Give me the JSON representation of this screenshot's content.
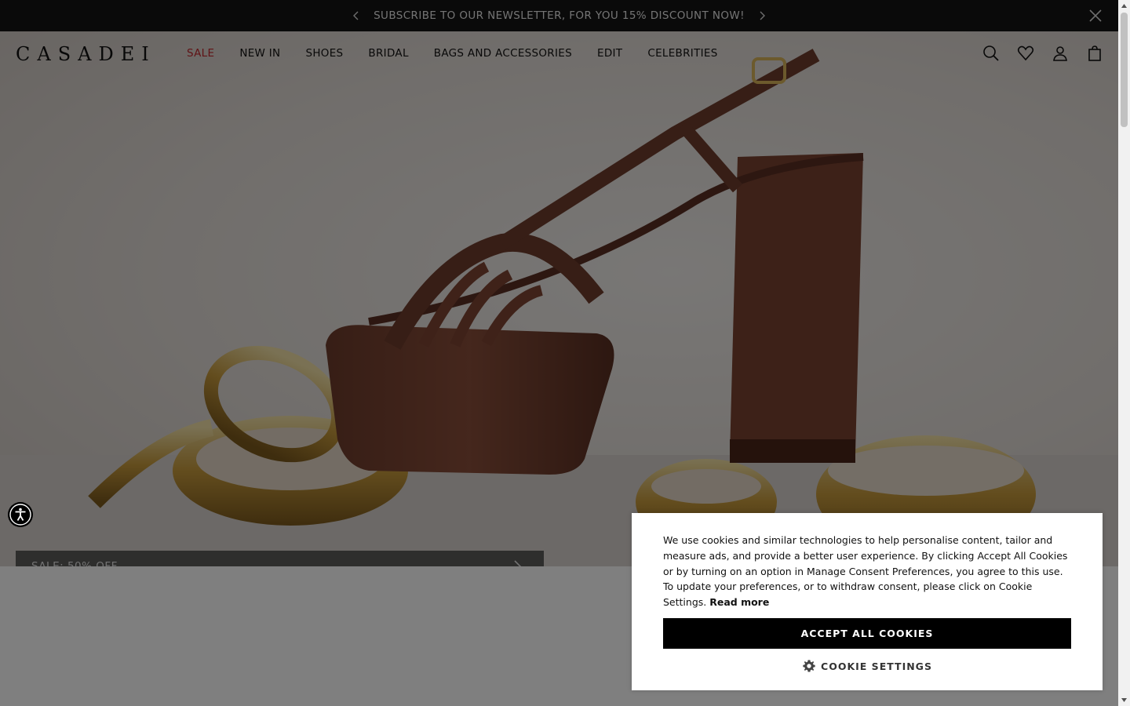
{
  "announcement": {
    "text": "SUBSCRIBE TO OUR NEWSLETTER, FOR YOU 15% DISCOUNT NOW!"
  },
  "header": {
    "logo": "CASADEI",
    "nav": [
      {
        "label": "SALE",
        "highlight": "#c0272d"
      },
      {
        "label": "NEW IN"
      },
      {
        "label": "SHOES"
      },
      {
        "label": "BRIDAL"
      },
      {
        "label": "BAGS AND ACCESSORIES"
      },
      {
        "label": "EDIT"
      },
      {
        "label": "CELEBRITIES"
      }
    ],
    "icons": [
      "search-icon",
      "wishlist-heart-icon",
      "account-icon",
      "shopping-bag-icon"
    ]
  },
  "hero": {
    "banner_label": "SALE: 50% OFF"
  },
  "cookie_banner": {
    "text": "We use cookies and similar technologies to help personalise content, tailor and measure ads, and provide a better user experience. By clicking Accept All Cookies or by turning on an option in Manage Consent Preferences, you agree to this use. To update your preferences, or to withdraw consent, please click on Cookie Settings.",
    "read_more": "Read more",
    "accept_label": "ACCEPT ALL COOKIES",
    "settings_label": "COOKIE SETTINGS"
  },
  "colors": {
    "announcement_bg": "#141414",
    "sale_accent": "#c0272d",
    "accept_button_bg": "#000000",
    "overlay": "rgba(0,0,0,0.5)"
  }
}
